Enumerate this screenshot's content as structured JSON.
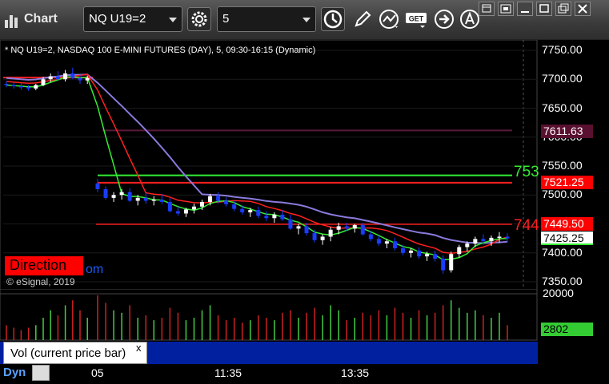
{
  "app": {
    "title": "Chart"
  },
  "toolbar": {
    "symbol": "NQ U19=2",
    "interval": "5",
    "get_label": "GET"
  },
  "chart_header": "* NQ U19=2, NASDAQ 100 E-MINI FUTURES (DAY), 5, 09:30-16:15 (Dynamic)",
  "copyright": "© eSignal, 2019",
  "direction_widget": {
    "label": "Direction",
    "tail": "om"
  },
  "price_axis": {
    "labels": [
      "7750.00",
      "7700.00",
      "7650.00",
      "7600.00",
      "7550.00",
      "7500.00",
      "7450.00",
      "7400.00",
      "7350.00"
    ]
  },
  "price_tags": {
    "maroon_level": "7611.63",
    "red_level_upper": "7521.25",
    "red_level_lower": "7449.50",
    "last_price": "7425.25"
  },
  "line_labels": {
    "green_line": "753",
    "red_line": "744"
  },
  "volume_pane": {
    "label": "Vol (current price bar)",
    "close_glyph": "x",
    "axis_label": "20000",
    "last_value": "2802"
  },
  "time_axis": {
    "labels": [
      "05",
      "11:35",
      "13:35"
    ],
    "dyn_label": "Dyn"
  },
  "colors": {
    "up_candle": "#ffffff",
    "down_candle": "#1a3cff",
    "ma_fast": "#ff2020",
    "ma_slow": "#8a7adc",
    "ma_green": "#33ee33",
    "support_line": "#ff2020",
    "target_line": "#33ee33"
  },
  "chart_data": {
    "type": "line",
    "symbol": "NQ U19=2",
    "interval": "5",
    "ylim": [
      7330,
      7765
    ],
    "y_ticks": [
      7750,
      7700,
      7650,
      7600,
      7550,
      7500,
      7450,
      7400,
      7350
    ],
    "horizontal_levels": [
      {
        "value": 7611.63,
        "color": "#6a1a40"
      },
      {
        "value": 7534,
        "color": "#33ee33"
      },
      {
        "value": 7521.25,
        "color": "#ff2020"
      },
      {
        "value": 7449.5,
        "color": "#ff2020"
      },
      {
        "value": 7703,
        "color": "#ff2020"
      }
    ],
    "candles": [
      [
        7692,
        7697,
        7686,
        7690
      ],
      [
        7690,
        7694,
        7684,
        7688
      ],
      [
        7688,
        7693,
        7682,
        7686
      ],
      [
        7686,
        7690,
        7680,
        7684
      ],
      [
        7684,
        7692,
        7681,
        7690
      ],
      [
        7690,
        7704,
        7688,
        7700
      ],
      [
        7700,
        7710,
        7695,
        7705
      ],
      [
        7705,
        7714,
        7698,
        7700
      ],
      [
        7700,
        7716,
        7696,
        7710
      ],
      [
        7710,
        7720,
        7700,
        7702
      ],
      [
        7702,
        7708,
        7692,
        7698
      ],
      [
        7698,
        7706,
        7692,
        7702
      ],
      [
        7520,
        7528,
        7505,
        7510
      ],
      [
        7510,
        7515,
        7492,
        7495
      ],
      [
        7495,
        7505,
        7488,
        7500
      ],
      [
        7500,
        7510,
        7492,
        7505
      ],
      [
        7505,
        7512,
        7488,
        7490
      ],
      [
        7490,
        7500,
        7482,
        7495
      ],
      [
        7495,
        7503,
        7485,
        7490
      ],
      [
        7490,
        7498,
        7482,
        7492
      ],
      [
        7492,
        7502,
        7484,
        7488
      ],
      [
        7488,
        7495,
        7470,
        7472
      ],
      [
        7472,
        7480,
        7464,
        7468
      ],
      [
        7468,
        7478,
        7462,
        7475
      ],
      [
        7475,
        7485,
        7468,
        7480
      ],
      [
        7480,
        7492,
        7474,
        7488
      ],
      [
        7488,
        7502,
        7482,
        7498
      ],
      [
        7498,
        7505,
        7485,
        7490
      ],
      [
        7490,
        7496,
        7480,
        7484
      ],
      [
        7484,
        7490,
        7472,
        7476
      ],
      [
        7476,
        7482,
        7466,
        7470
      ],
      [
        7470,
        7478,
        7462,
        7474
      ],
      [
        7474,
        7480,
        7460,
        7464
      ],
      [
        7464,
        7472,
        7455,
        7460
      ],
      [
        7460,
        7470,
        7452,
        7466
      ],
      [
        7466,
        7474,
        7455,
        7458
      ],
      [
        7458,
        7466,
        7440,
        7442
      ],
      [
        7442,
        7450,
        7432,
        7446
      ],
      [
        7446,
        7452,
        7430,
        7434
      ],
      [
        7434,
        7440,
        7418,
        7422
      ],
      [
        7422,
        7432,
        7414,
        7428
      ],
      [
        7428,
        7445,
        7420,
        7440
      ],
      [
        7440,
        7452,
        7432,
        7446
      ],
      [
        7446,
        7452,
        7438,
        7442
      ],
      [
        7442,
        7450,
        7435,
        7448
      ],
      [
        7448,
        7452,
        7430,
        7432
      ],
      [
        7432,
        7438,
        7420,
        7424
      ],
      [
        7424,
        7430,
        7412,
        7416
      ],
      [
        7416,
        7424,
        7408,
        7420
      ],
      [
        7420,
        7426,
        7404,
        7408
      ],
      [
        7408,
        7414,
        7396,
        7400
      ],
      [
        7400,
        7408,
        7392,
        7404
      ],
      [
        7404,
        7410,
        7390,
        7394
      ],
      [
        7394,
        7402,
        7386,
        7398
      ],
      [
        7398,
        7404,
        7385,
        7390
      ],
      [
        7390,
        7396,
        7364,
        7370
      ],
      [
        7370,
        7402,
        7366,
        7398
      ],
      [
        7398,
        7414,
        7392,
        7410
      ],
      [
        7410,
        7420,
        7402,
        7416
      ],
      [
        7416,
        7428,
        7410,
        7424
      ],
      [
        7424,
        7432,
        7414,
        7420
      ],
      [
        7420,
        7430,
        7412,
        7426
      ],
      [
        7426,
        7436,
        7418,
        7428
      ],
      [
        7428,
        7434,
        7418,
        7425
      ]
    ],
    "volume": [
      6,
      5,
      4,
      5,
      6,
      9,
      12,
      10,
      14,
      16,
      12,
      9,
      18,
      15,
      12,
      11,
      14,
      9,
      10,
      8,
      9,
      13,
      11,
      8,
      9,
      12,
      14,
      10,
      8,
      9,
      7,
      8,
      10,
      9,
      8,
      11,
      12,
      9,
      11,
      13,
      10,
      14,
      12,
      8,
      9,
      11,
      10,
      12,
      10,
      13,
      11,
      9,
      12,
      10,
      11,
      14,
      16,
      13,
      11,
      12,
      10,
      9,
      11,
      6
    ],
    "volume_ylim": [
      0,
      20000
    ],
    "volume_last": 2802
  }
}
